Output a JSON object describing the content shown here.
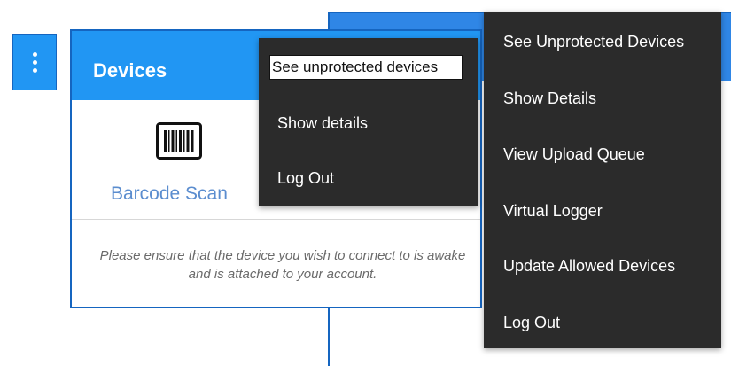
{
  "toolbar": {
    "overflow_icon": "more-vertical-icon"
  },
  "card": {
    "title": "Devices",
    "barcode": {
      "icon": "barcode-icon",
      "label": "Barcode Scan"
    },
    "note": "Please ensure that the device you wish to connect to is awake and is attached to your account."
  },
  "menu_small": {
    "items": [
      {
        "label": "See unprotected devices"
      },
      {
        "label": "Show details"
      },
      {
        "label": "Log Out"
      }
    ]
  },
  "menu_large": {
    "items": [
      {
        "label": "See Unprotected Devices"
      },
      {
        "label": "Show Details"
      },
      {
        "label": "View Upload Queue"
      },
      {
        "label": "Virtual Logger"
      },
      {
        "label": "Update Allowed Devices"
      },
      {
        "label": "Log Out"
      }
    ]
  },
  "colors": {
    "primary": "#2196f3",
    "primary_dark": "#1565c0",
    "menu_bg": "#2b2b2b",
    "link_text": "#5b8dcf"
  }
}
